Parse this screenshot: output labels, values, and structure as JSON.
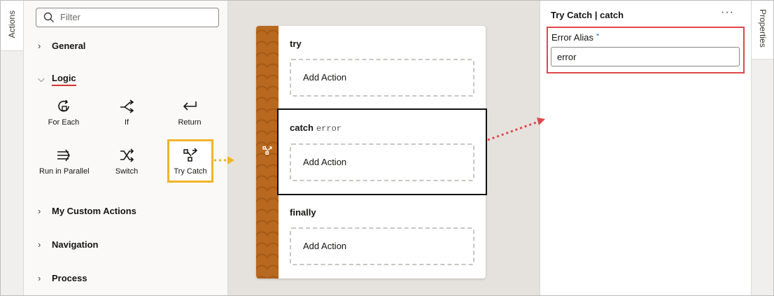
{
  "left_tab": {
    "label": "Actions"
  },
  "right_tab": {
    "label": "Properties"
  },
  "palette": {
    "filter_placeholder": "Filter",
    "sections": {
      "general": "General",
      "logic": "Logic",
      "custom": "My Custom Actions",
      "navigation": "Navigation",
      "process": "Process"
    },
    "logic_items": [
      {
        "label": "For Each",
        "icon": "for-each-icon"
      },
      {
        "label": "If",
        "icon": "if-icon"
      },
      {
        "label": "Return",
        "icon": "return-icon"
      },
      {
        "label": "Run in Parallel",
        "icon": "run-in-parallel-icon"
      },
      {
        "label": "Switch",
        "icon": "switch-icon"
      },
      {
        "label": "Try Catch",
        "icon": "try-catch-icon",
        "selected": true
      }
    ]
  },
  "canvas": {
    "blocks": {
      "try": {
        "label": "try",
        "add_action": "Add Action"
      },
      "catch": {
        "label": "catch",
        "alias": "error",
        "add_action": "Add Action"
      },
      "finally": {
        "label": "finally",
        "add_action": "Add Action"
      }
    }
  },
  "properties": {
    "title": "Try Catch | catch",
    "more": "···",
    "field_label": "Error Alias",
    "required_mark": "*",
    "field_value": "error"
  },
  "colors": {
    "highlight_yellow": "#f0b428",
    "highlight_red": "#e0464a",
    "stripe_brown": "#b8691f",
    "required_blue": "#1f73c9"
  }
}
